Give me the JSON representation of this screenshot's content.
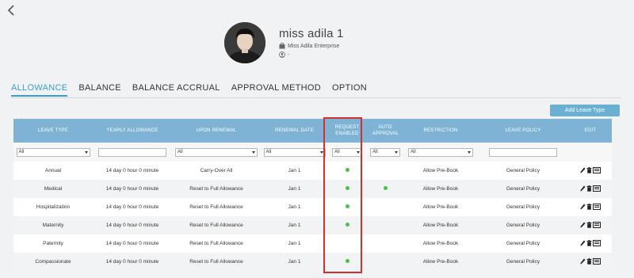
{
  "header": {
    "back_icon": "chevron-left-icon"
  },
  "profile": {
    "name": "miss adila 1",
    "company": "Miss Adila Enterprise",
    "employee_id": "-"
  },
  "tabs": [
    {
      "label": "ALLOWANCE",
      "active": true
    },
    {
      "label": "BALANCE",
      "active": false
    },
    {
      "label": "BALANCE ACCRUAL",
      "active": false
    },
    {
      "label": "APPROVAL METHOD",
      "active": false
    },
    {
      "label": "OPTION",
      "active": false
    }
  ],
  "toolbar": {
    "add_label": "Add Leave Type"
  },
  "table": {
    "columns": [
      "LEAVE TYPE",
      "YEARLY ALLOWANCE",
      "UPON RENEWAL",
      "RENEWAL DATE",
      "REQUEST ENABLED",
      "AUTO APPROVAL",
      "RESTRICTION",
      "LEAVE POLICY",
      "EDIT"
    ],
    "filters": {
      "leave_type": "All",
      "upon_renewal": "All",
      "renewal_date": "All",
      "request_enabled": "All",
      "auto_approval": "All",
      "restriction": "All"
    },
    "rows": [
      {
        "leave_type": "Annual",
        "yearly": "14 day 0 hour 0 minute",
        "renewal": "Carry-Over All",
        "date": "Jan 1",
        "request_enabled": true,
        "auto_approval": false,
        "restriction": "Allow Pre-Book",
        "policy": "General Policy"
      },
      {
        "leave_type": "Medical",
        "yearly": "14 day 0 hour 0 minute",
        "renewal": "Reset to Full Allowance",
        "date": "Jan 1",
        "request_enabled": true,
        "auto_approval": true,
        "restriction": "Allow Pre-Book",
        "policy": "General Policy"
      },
      {
        "leave_type": "Hospitalization",
        "yearly": "14 day 0 hour 0 minute",
        "renewal": "Reset to Full Allowance",
        "date": "Jan 1",
        "request_enabled": true,
        "auto_approval": false,
        "restriction": "Allow Pre-Book",
        "policy": "General Policy"
      },
      {
        "leave_type": "Maternity",
        "yearly": "14 day 0 hour 0 minute",
        "renewal": "Reset to Full Allowance",
        "date": "Jan 1",
        "request_enabled": true,
        "auto_approval": false,
        "restriction": "Allow Pre-Book",
        "policy": "General Policy"
      },
      {
        "leave_type": "Paternity",
        "yearly": "14 day 0 hour 0 minute",
        "renewal": "Reset to Full Allowance",
        "date": "Jan 1",
        "request_enabled": false,
        "auto_approval": false,
        "restriction": "Allow Pre-Book",
        "policy": "General Policy"
      },
      {
        "leave_type": "Compassionate",
        "yearly": "14 day 0 hour 0 minute",
        "renewal": "Reset to Full Allowance",
        "date": "Jan 1",
        "request_enabled": true,
        "auto_approval": false,
        "restriction": "Allow Pre-Book",
        "policy": "General Policy"
      }
    ]
  },
  "colors": {
    "accent": "#3b9ec9",
    "header_bg": "#7fb3d5",
    "button_bg": "#6ab0d3",
    "dot": "#4bbf4b",
    "highlight": "#d32f2f"
  }
}
